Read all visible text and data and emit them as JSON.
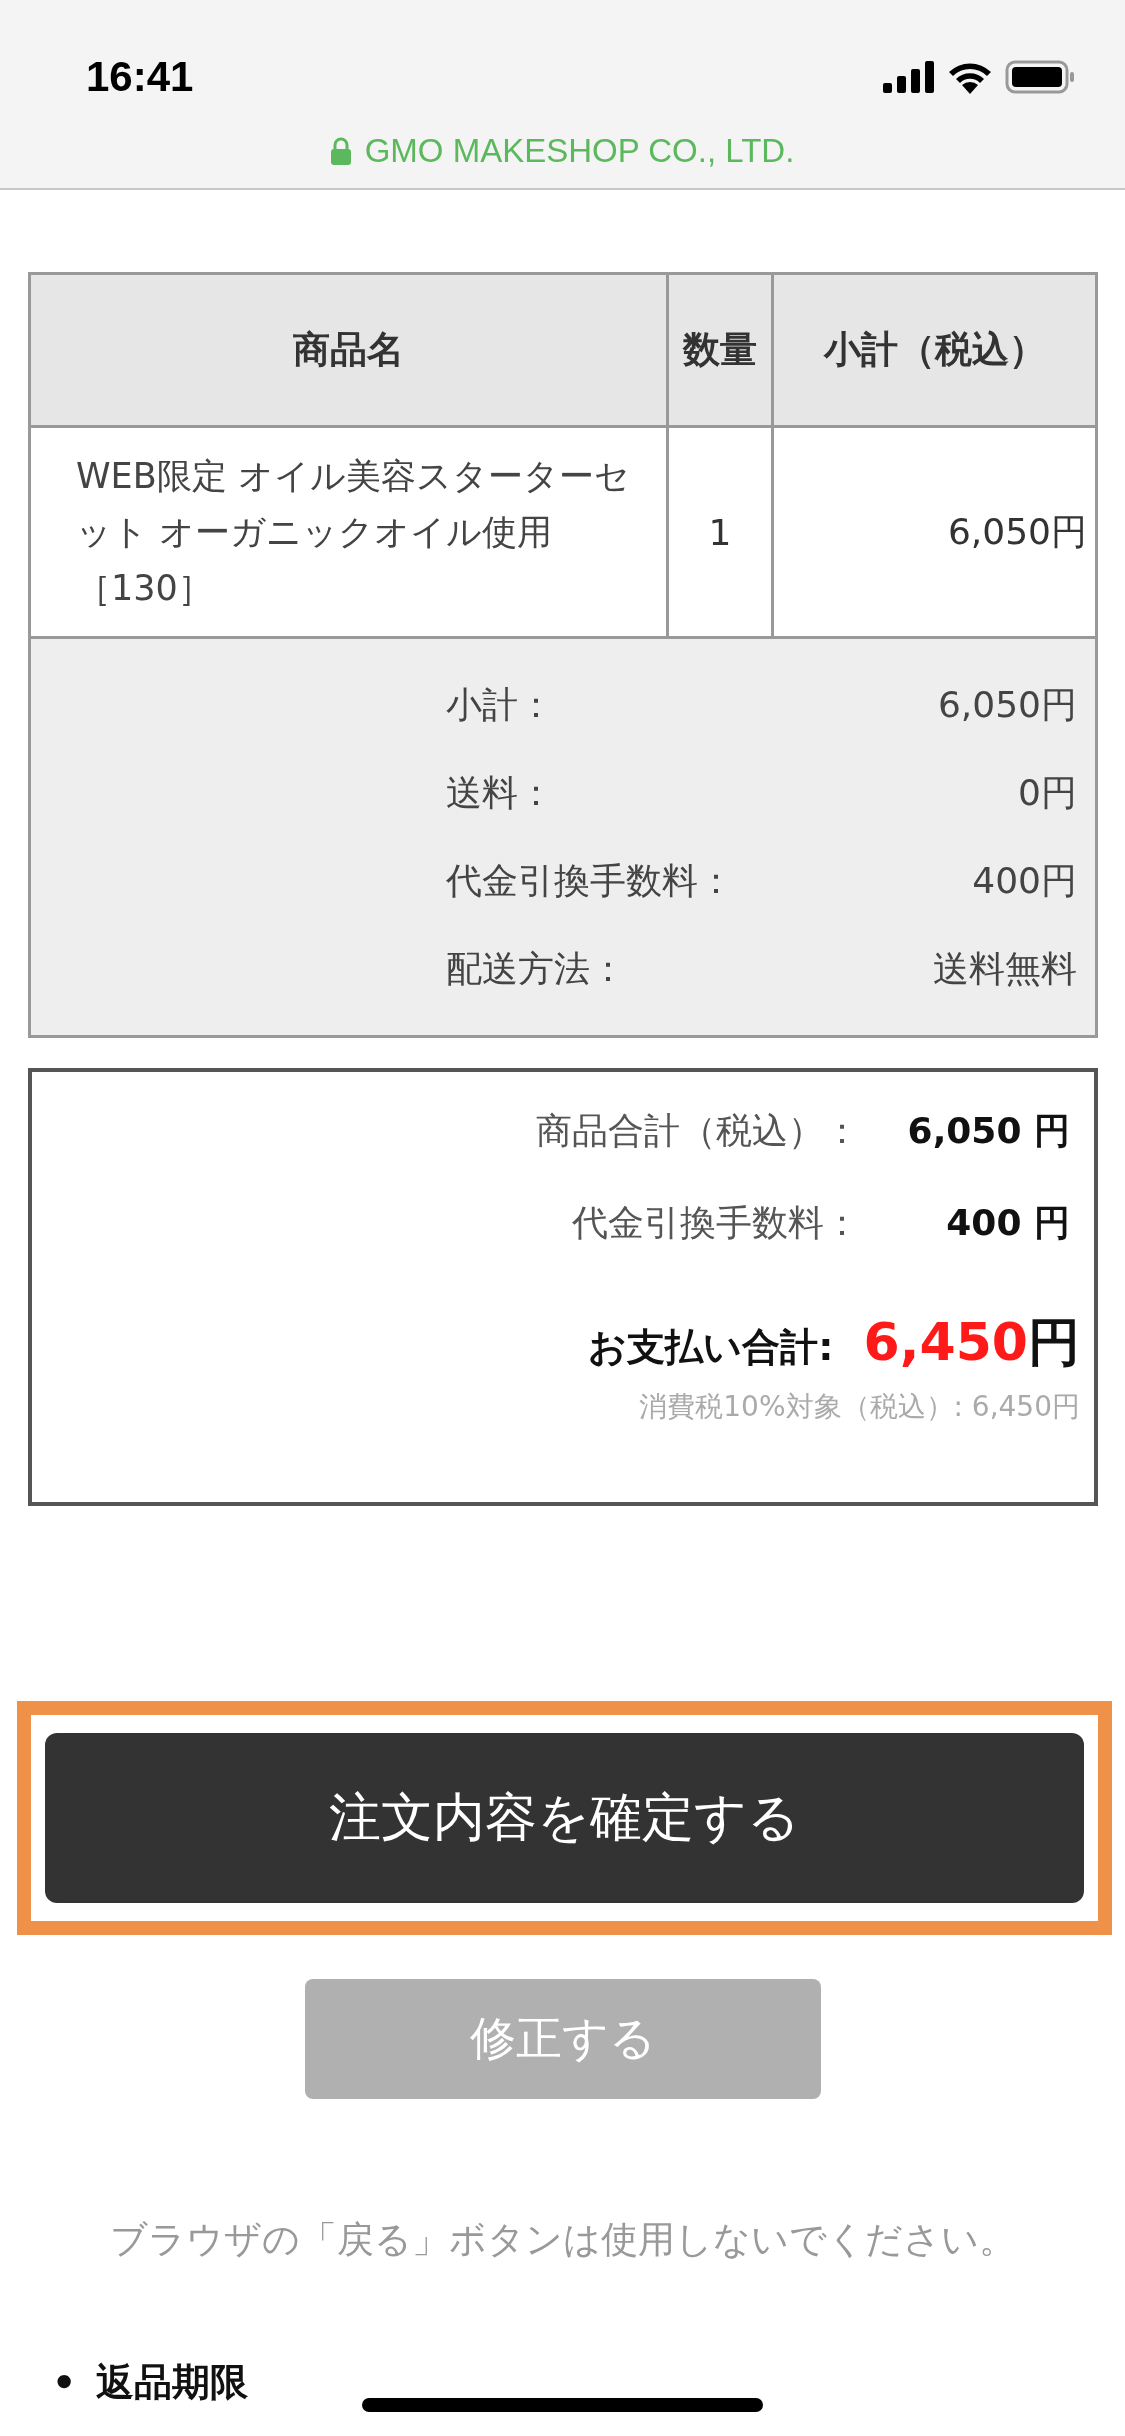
{
  "status_bar": {
    "time": "16:41"
  },
  "address_bar": {
    "secure": true,
    "text": "GMO MAKESHOP CO., LTD."
  },
  "order_table": {
    "columns": [
      "商品名",
      "数量",
      "小計（税込）"
    ],
    "rows": [
      {
        "name": "WEB限定 オイル美容スターターセット オーガニックオイル使用［130］",
        "quantity": "1",
        "subtotal": "6,050円"
      }
    ],
    "summary": [
      {
        "label": "小計：",
        "value": "6,050円"
      },
      {
        "label": "送料：",
        "value": "0円"
      },
      {
        "label": "代金引換手数料：",
        "value": "400円"
      },
      {
        "label": "配送方法：",
        "value": "送料無料"
      }
    ]
  },
  "totals": {
    "lines": [
      {
        "label": "商品合計（税込）：",
        "value": "6,050 円"
      },
      {
        "label": "代金引換手数料：",
        "value": "400 円"
      }
    ],
    "grand_label": "お支払い合計:",
    "grand_value": "6,450",
    "grand_unit": "円",
    "tax_note": "消費税10%対象（税込）: 6,450円"
  },
  "confirm_button": {
    "label": "注文内容を確定する",
    "highlighted": true
  },
  "edit_button": {
    "label": "修正する"
  },
  "notice": "ブラウザの「戻る」ボタンは使用しないでください。",
  "next_section": {
    "bullet": "•",
    "title": "返品期限"
  }
}
